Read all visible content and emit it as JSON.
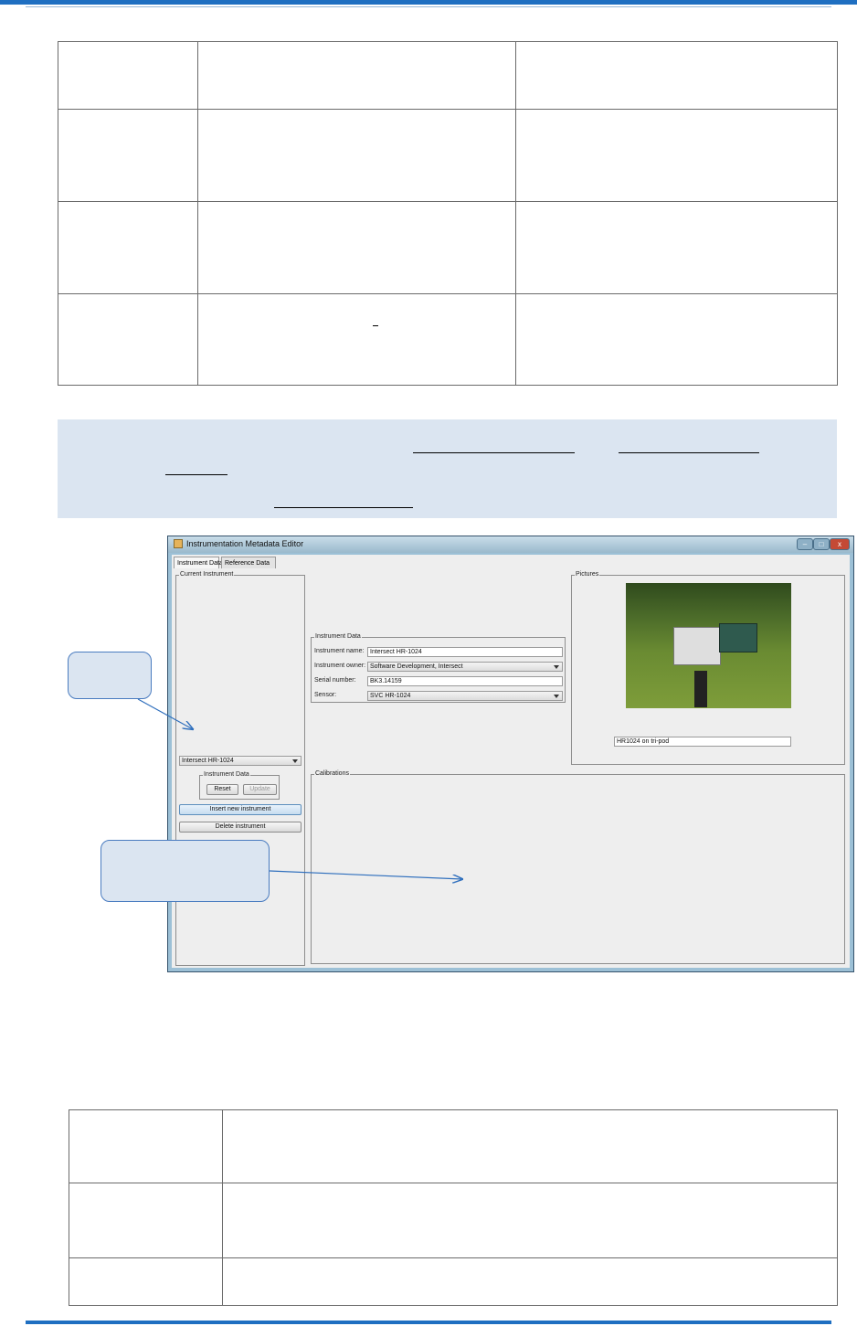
{
  "window": {
    "title": "Instrumentation Metadata Editor",
    "buttons": {
      "minimize": "–",
      "maximize": "□",
      "close": "x"
    }
  },
  "tabs": [
    "Instrument Data",
    "Reference Data"
  ],
  "current_instrument": {
    "legend": "Current Instrument",
    "selected": "Intersect HR-1024",
    "group_legend": "Instrument Data",
    "reset_label": "Reset",
    "update_label": "Update",
    "insert_label": "Insert new instrument",
    "delete_label": "Delete instrument"
  },
  "instrument_data": {
    "legend": "Instrument Data",
    "name_label": "Instrument name:",
    "name_value": "Intersect HR-1024",
    "owner_label": "Instrument owner:",
    "owner_value": "Software Development, Intersect",
    "serial_label": "Serial number:",
    "serial_value": "BK3.14159",
    "sensor_label": "Sensor:",
    "sensor_value": "SVC HR-1024"
  },
  "pictures": {
    "legend": "Pictures",
    "caption": "HR1024 on tri-pod"
  },
  "calibrations": {
    "legend": "Calibrations"
  },
  "icons": [
    "app-icon",
    "dropdown-arrow-icon",
    "minimize-icon",
    "maximize-icon",
    "close-icon"
  ],
  "colors": {
    "accent": "#1f6fc1",
    "note_bg": "#dbe5f1",
    "callout_border": "#4a7cc0"
  }
}
